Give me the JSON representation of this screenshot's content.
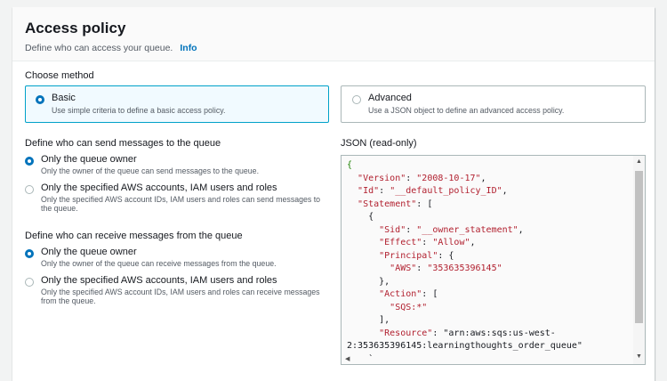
{
  "header": {
    "title": "Access policy",
    "description": "Define who can access your queue.",
    "info_link": "Info"
  },
  "method": {
    "label": "Choose method",
    "basic": {
      "title": "Basic",
      "desc": "Use simple criteria to define a basic access policy.",
      "selected": true
    },
    "advanced": {
      "title": "Advanced",
      "desc": "Use a JSON object to define an advanced access policy.",
      "selected": false
    }
  },
  "send": {
    "label": "Define who can send messages to the queue",
    "options": [
      {
        "title": "Only the queue owner",
        "desc": "Only the owner of the queue can send messages to the queue.",
        "selected": true
      },
      {
        "title": "Only the specified AWS accounts, IAM users and roles",
        "desc": "Only the specified AWS account IDs, IAM users and roles can send messages to the queue.",
        "selected": false
      }
    ]
  },
  "receive": {
    "label": "Define who can receive messages from the queue",
    "options": [
      {
        "title": "Only the queue owner",
        "desc": "Only the owner of the queue can receive messages from the queue.",
        "selected": true
      },
      {
        "title": "Only the specified AWS accounts, IAM users and roles",
        "desc": "Only the specified AWS account IDs, IAM users and roles can receive messages from the queue.",
        "selected": false
      }
    ]
  },
  "json_view": {
    "label": "JSON (read-only)",
    "lines": [
      "{",
      "  \"Version\": \"2008-10-17\",",
      "  \"Id\": \"__default_policy_ID\",",
      "  \"Statement\": [",
      "    {",
      "      \"Sid\": \"__owner_statement\",",
      "      \"Effect\": \"Allow\",",
      "      \"Principal\": {",
      "        \"AWS\": \"353635396145\"",
      "      },",
      "      \"Action\": [",
      "        \"SQS:*\"",
      "      ],",
      "      \"Resource\": \"arn:aws:sqs:us-west-",
      "2:353635396145:learningthoughts_order_queue\"",
      "    `"
    ]
  },
  "colors": {
    "accent": "#0073bb",
    "selected_bg": "#f1faff",
    "selected_border": "#00a1c9",
    "json_key": "#b11f2e"
  }
}
